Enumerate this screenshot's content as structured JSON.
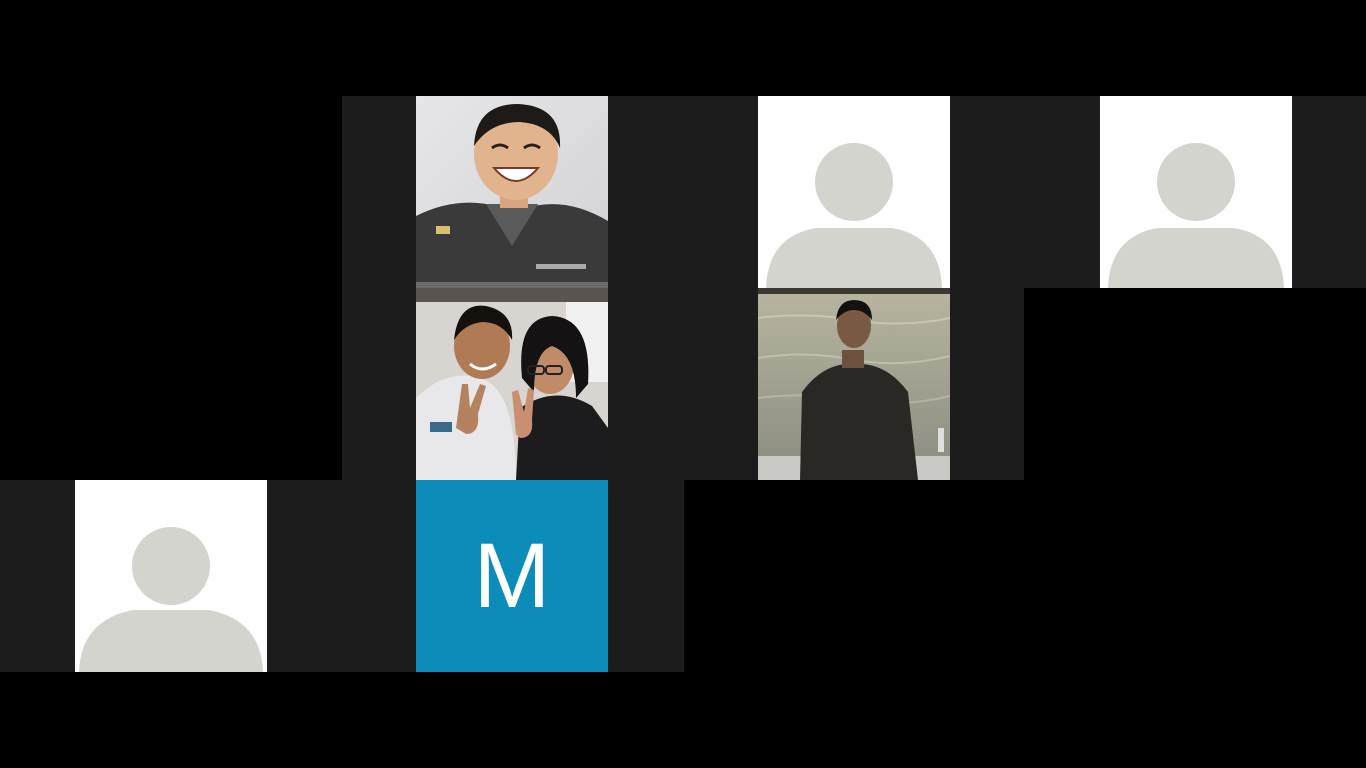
{
  "colors": {
    "background": "#000000",
    "grid_cell": "#1c1c1c",
    "avatar_bg": "#ffffff",
    "avatar_silhouette": "#d4d4cf",
    "initial_tile_bg": "#0c8cb8",
    "initial_text": "#ffffff"
  },
  "participants": [
    {
      "kind": "photo",
      "description_icon": "person-smiling-photo"
    },
    {
      "kind": "avatar",
      "icon": "default-avatar-icon"
    },
    {
      "kind": "avatar",
      "icon": "default-avatar-icon"
    },
    {
      "kind": "photo",
      "description_icon": "two-people-peace-sign-photo"
    },
    {
      "kind": "photo",
      "description_icon": "person-by-lake-photo"
    },
    {
      "kind": "avatar",
      "icon": "default-avatar-icon"
    },
    {
      "kind": "initial",
      "initial": "M"
    }
  ]
}
